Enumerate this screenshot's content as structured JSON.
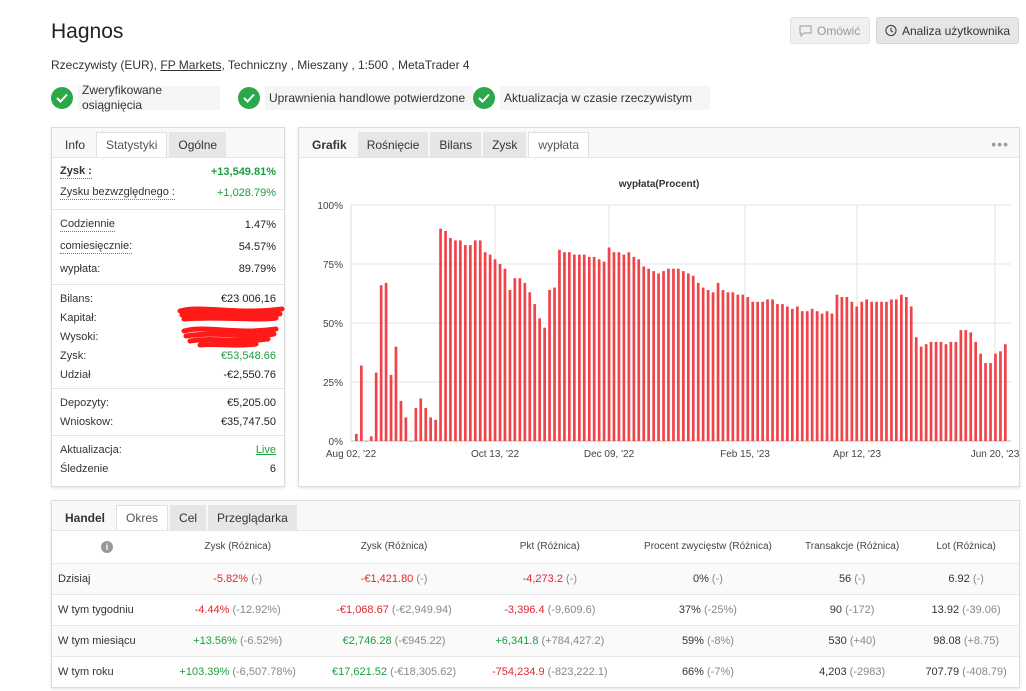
{
  "header": {
    "title": "Hagnos",
    "account_type": "Rzeczywisty (EUR),",
    "broker": "FP Markets",
    "details": ", Techniczny , Mieszany , 1:500 , MetaTrader 4",
    "comment_button": "Omówić",
    "analysis_button": "Analiza użytkownika"
  },
  "badges": [
    {
      "icon": "check-icon",
      "text": "Zweryfikowane osiągnięcia"
    },
    {
      "icon": "check-icon",
      "text": "Uprawnienia handlowe potwierdzone"
    },
    {
      "icon": "check-icon",
      "text": "Aktualizacja w czasie rzeczywistym"
    }
  ],
  "stats": {
    "tabs": [
      "Info",
      "Statystyki",
      "Ogólne"
    ],
    "active_tab": "Statystyki",
    "rows": {
      "zysk_label": "Zysk :",
      "zysk_value": "+13,549.81%",
      "abs_label": "Zysku bezwzględnego :",
      "abs_value": "+1,028.79%",
      "daily_label": "Codziennie",
      "daily_value": "1.47%",
      "monthly_label": "comiesięcznie:",
      "monthly_value": "54.57%",
      "drawdown_label": "wypłata:",
      "drawdown_value": "89.79%",
      "balance_label": "Bilans:",
      "balance_value": "€23 006,16",
      "equity_label": "Kapitał:",
      "high_label": "Wysoki:",
      "profit_label": "Zysk:",
      "profit_value": "€53,548.66",
      "share_label": "Udział",
      "share_value": "-€2,550.76",
      "deposits_label": "Depozyty:",
      "deposits_value": "€5,205.00",
      "withdrawals_label": "Wnioskow:",
      "withdrawals_value": "€35,747.50",
      "update_label": "Aktualizacja:",
      "update_value": "Live",
      "tracking_label": "Śledzenie",
      "tracking_value": "6"
    }
  },
  "chart_panel": {
    "tabs": [
      "Grafik",
      "Rośnięcie",
      "Bilans",
      "Zysk",
      "wypłata"
    ],
    "active_tab": "wypłata",
    "more_icon": "more-dots-icon"
  },
  "chart_data": {
    "type": "bar",
    "title": "wypłata(Procent)",
    "xlabel": "",
    "ylabel": "",
    "ylim": [
      0,
      100
    ],
    "yticks": [
      "0%",
      "25%",
      "50%",
      "75%",
      "100%"
    ],
    "xticks": [
      "Aug 02, '22",
      "Oct 13, '22",
      "Dec 09, '22",
      "Feb 15, '23",
      "Apr 12, '23",
      "Jun 20, '23"
    ],
    "x_range": [
      "2022-08-02",
      "2023-06-28"
    ],
    "x_tick_dates": [
      "2022-08-02",
      "2022-10-13",
      "2022-12-09",
      "2023-02-15",
      "2023-04-12",
      "2023-06-20"
    ],
    "color": "#f0444a",
    "grid": true,
    "values": [
      3,
      32,
      0,
      2,
      29,
      66,
      67,
      28,
      40,
      17,
      10,
      0,
      14,
      18,
      14,
      10,
      9,
      90,
      89,
      86,
      85,
      85,
      83,
      83,
      85,
      85,
      80,
      79,
      77,
      75,
      73,
      64,
      69,
      69,
      67,
      63,
      58,
      52,
      48,
      64,
      65,
      81,
      80,
      80,
      79,
      79,
      79,
      78,
      78,
      77,
      76,
      82,
      80,
      80,
      79,
      80,
      78,
      77,
      74,
      73,
      72,
      71,
      72,
      73,
      73,
      73,
      72,
      71,
      70,
      67,
      65,
      64,
      63,
      67,
      64,
      63,
      63,
      62,
      62,
      61,
      59,
      59,
      59,
      60,
      60,
      58,
      58,
      57,
      56,
      57,
      55,
      55,
      56,
      55,
      54,
      55,
      54,
      62,
      61,
      61,
      59,
      57,
      59,
      60,
      59,
      59,
      59,
      59,
      60,
      60,
      62,
      61,
      57,
      44,
      40,
      41,
      42,
      42,
      42,
      41,
      42,
      42,
      47,
      47,
      46,
      42,
      37,
      33,
      33,
      37,
      38,
      41
    ]
  },
  "trade": {
    "tabs": [
      "Handel",
      "Okres",
      "Cel",
      "Przeglądarka"
    ],
    "active_tab": "Okres",
    "info_icon": "info-icon",
    "columns": [
      "Zysk (Różnica)",
      "Zysk (Różnica)",
      "Pkt (Różnica)",
      "Procent zwycięstw (Różnica)",
      "Transakcje (Różnica)",
      "Lot (Różnica)"
    ],
    "rows": [
      {
        "label": "Dzisiaj",
        "cells": [
          {
            "v": "-5.82%",
            "d": "(-)",
            "c": "red"
          },
          {
            "v": "-€1,421.80",
            "d": "(-)",
            "c": "red"
          },
          {
            "v": "-4,273.2",
            "d": "(-)",
            "c": "red"
          },
          {
            "v": "0%",
            "d": "(-)",
            "c": ""
          },
          {
            "v": "56",
            "d": "(-)",
            "c": ""
          },
          {
            "v": "6.92",
            "d": "(-)",
            "c": ""
          }
        ]
      },
      {
        "label": "W tym tygodniu",
        "cells": [
          {
            "v": "-4.44%",
            "d": "(-12.92%)",
            "c": "red"
          },
          {
            "v": "-€1,068.67",
            "d": "(-€2,949.94)",
            "c": "red"
          },
          {
            "v": "-3,396.4",
            "d": "(-9,609.6)",
            "c": "red"
          },
          {
            "v": "37%",
            "d": "(-25%)",
            "c": ""
          },
          {
            "v": "90",
            "d": "(-172)",
            "c": ""
          },
          {
            "v": "13.92",
            "d": "(-39.06)",
            "c": ""
          }
        ]
      },
      {
        "label": "W tym miesiącu",
        "cells": [
          {
            "v": "+13.56%",
            "d": "(-6.52%)",
            "c": "green"
          },
          {
            "v": "€2,746.28",
            "d": "(-€945.22)",
            "c": "green"
          },
          {
            "v": "+6,341.8",
            "d": "(+784,427.2)",
            "c": "green"
          },
          {
            "v": "59%",
            "d": "(-8%)",
            "c": ""
          },
          {
            "v": "530",
            "d": "(+40)",
            "c": ""
          },
          {
            "v": "98.08",
            "d": "(+8.75)",
            "c": ""
          }
        ]
      },
      {
        "label": "W tym roku",
        "cells": [
          {
            "v": "+103.39%",
            "d": "(-6,507.78%)",
            "c": "green"
          },
          {
            "v": "€17,621.52",
            "d": "(-€18,305.62)",
            "c": "green"
          },
          {
            "v": "-754,234.9",
            "d": "(-823,222.1)",
            "c": "red"
          },
          {
            "v": "66%",
            "d": "(-7%)",
            "c": ""
          },
          {
            "v": "4,203",
            "d": "(-2983)",
            "c": ""
          },
          {
            "v": "707.79",
            "d": "(-408.79)",
            "c": ""
          }
        ]
      }
    ]
  }
}
